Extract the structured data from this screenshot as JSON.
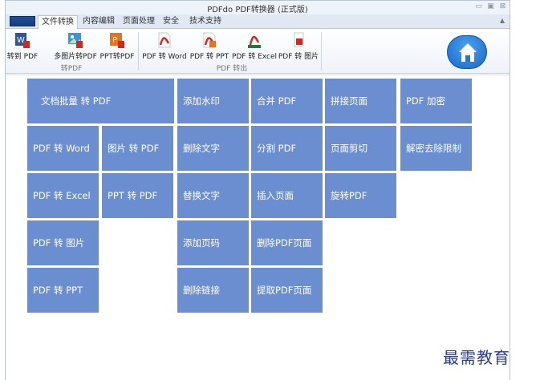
{
  "window": {
    "title": "PDFdo PDF转换器 (正式版)"
  },
  "tabs": [
    {
      "label": "文件转换",
      "active": true
    },
    {
      "label": "内容编辑"
    },
    {
      "label": "页面处理"
    },
    {
      "label": "安全"
    },
    {
      "label": "技术支持"
    }
  ],
  "ribbon": {
    "group1": {
      "label": "转PDF",
      "buttons": [
        {
          "label": "转到 PDF",
          "icon": "word-to-pdf-icon"
        },
        {
          "label": "多图片转PDF",
          "icon": "images-to-pdf-icon"
        },
        {
          "label": "PPT转PDF",
          "icon": "ppt-to-pdf-icon"
        }
      ]
    },
    "group2": {
      "label": "PDF 转出",
      "buttons": [
        {
          "label": "PDF 转 Word",
          "icon": "pdf-to-word-icon"
        },
        {
          "label": "PDF 转 PPT",
          "icon": "pdf-to-ppt-icon"
        },
        {
          "label": "PDF 转 Excel",
          "icon": "pdf-to-excel-icon"
        },
        {
          "label": "PDF 转 图片",
          "icon": "pdf-to-image-icon"
        }
      ]
    }
  },
  "tiles": {
    "batch": "文档批量 转 PDF",
    "watermark": "添加水印",
    "merge": "合并 PDF",
    "splice": "拼接页面",
    "encrypt": "PDF 加密",
    "to_word": "PDF 转 Word",
    "img_to_pdf": "图片 转 PDF",
    "delete_text": "删除文字",
    "split": "分割 PDF",
    "crop": "页面剪切",
    "decrypt": "解密去除限制",
    "to_excel": "PDF 转 Excel",
    "ppt_to_pdf": "PPT 转 PDF",
    "replace_text": "替换文字",
    "insert_page": "插入页面",
    "rotate": "旋转PDF",
    "to_image": "PDF 转 图片",
    "page_number": "添加页码",
    "delete_page": "删除PDF页面",
    "to_ppt": "PDF 转 PPT",
    "delete_link": "删除链接",
    "extract_page": "提取PDF页面"
  },
  "watermark_text": "最需教育",
  "colors": {
    "tile": "#6b8ed0",
    "home": "#1f78d6",
    "ribbon_bg": "#eef3f9"
  }
}
